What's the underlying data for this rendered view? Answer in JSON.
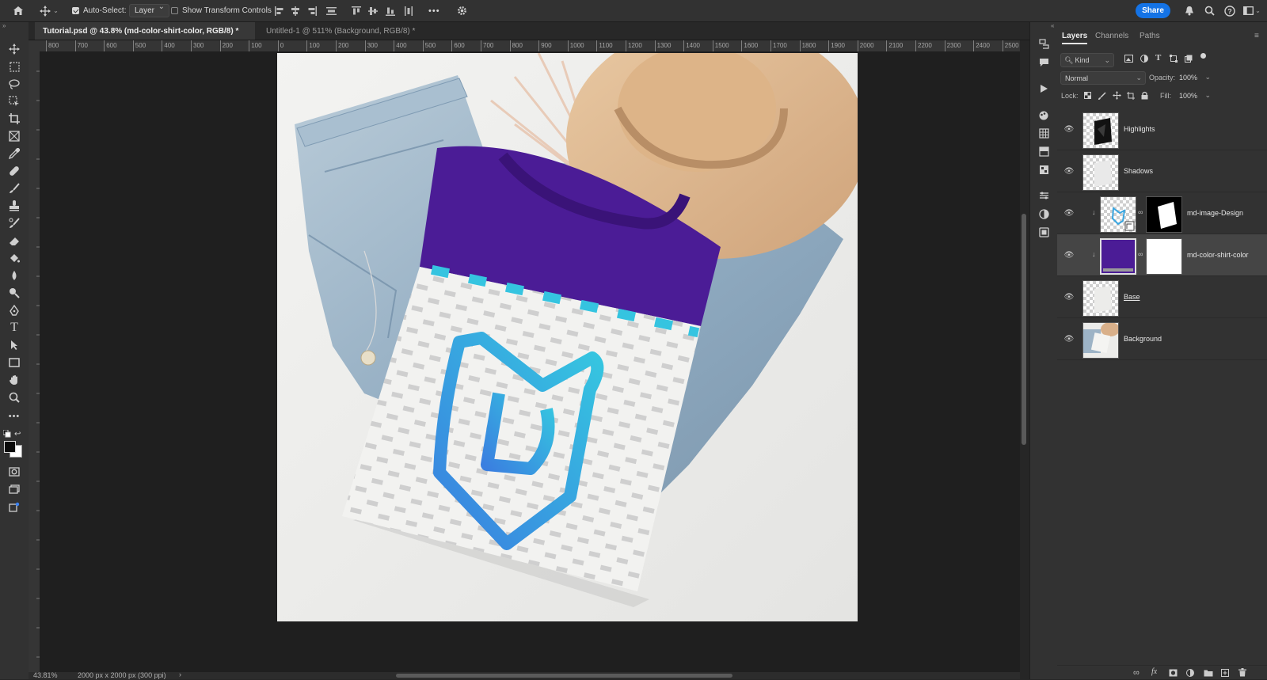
{
  "options_bar": {
    "auto_select_label": "Auto-Select:",
    "auto_select_checked": true,
    "auto_select_target": "Layer",
    "show_transform_label": "Show Transform Controls",
    "show_transform_checked": false,
    "more_label": "•••",
    "share_label": "Share"
  },
  "doc_tabs": [
    {
      "label": "Tutorial.psd @ 43.8% (md-color-shirt-color, RGB/8) *",
      "active": true
    },
    {
      "label": "Untitled-1 @ 511% (Background, RGB/8) *",
      "active": false
    }
  ],
  "ruler": {
    "ticks": [
      "800",
      "700",
      "600",
      "500",
      "400",
      "300",
      "200",
      "100",
      "0",
      "100",
      "200",
      "300",
      "400",
      "500",
      "600",
      "700",
      "800",
      "900",
      "1000",
      "1100",
      "1200",
      "1300",
      "1400",
      "1500",
      "1600",
      "1700",
      "1800",
      "1900",
      "2000",
      "2100",
      "2200",
      "2300",
      "2400",
      "2500"
    ]
  },
  "status": {
    "zoom": "43.81%",
    "doc_info": "2000 px x 2000 px (300 ppi)",
    "arrow": "›"
  },
  "layers_panel": {
    "tabs": [
      "Layers",
      "Channels",
      "Paths"
    ],
    "filter_kind": "Kind",
    "blend_mode": "Normal",
    "opacity_label": "Opacity:",
    "opacity_value": "100%",
    "lock_label": "Lock:",
    "fill_label": "Fill:",
    "fill_value": "100%",
    "layers": [
      {
        "name": "Highlights",
        "visible": true
      },
      {
        "name": "Shadows",
        "visible": true
      },
      {
        "name": "md-image-Design",
        "visible": true,
        "clipped": true
      },
      {
        "name": "md-color-shirt-color",
        "visible": true,
        "clipped": true,
        "selected": true,
        "fill_color": "#4b1c96"
      },
      {
        "name": "Base",
        "visible": true
      },
      {
        "name": "Background",
        "visible": true
      }
    ]
  },
  "colors": {
    "shirt_purple": "#4b1c96",
    "accent_cyan": "#35c4e0",
    "logo_blue": "#2f8fe0",
    "share_blue": "#1473e6"
  }
}
